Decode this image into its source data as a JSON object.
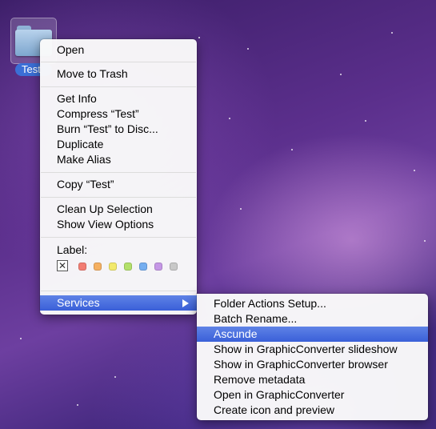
{
  "desktop": {
    "folder_label": "Test"
  },
  "context_menu": {
    "open": "Open",
    "move_to_trash": "Move to Trash",
    "get_info": "Get Info",
    "compress": "Compress “Test”",
    "burn": "Burn “Test” to Disc...",
    "duplicate": "Duplicate",
    "make_alias": "Make Alias",
    "copy": "Copy “Test”",
    "clean_up": "Clean Up Selection",
    "show_view_options": "Show View Options",
    "label_heading": "Label:",
    "label_none_glyph": "✕",
    "label_colors": [
      "#f27d73",
      "#f5b061",
      "#f2e96b",
      "#b3e06a",
      "#75aef0",
      "#c597e6",
      "#c8c8c8"
    ],
    "services": "Services"
  },
  "services_submenu": {
    "items": [
      "Folder Actions Setup...",
      "Batch Rename...",
      "Ascunde",
      "Show in GraphicConverter slideshow",
      "Show in GraphicConverter browser",
      "Remove metadata",
      "Open in GraphicConverter",
      "Create icon and preview"
    ],
    "highlighted_index": 2
  },
  "colors": {
    "highlight": "#3a5fd8"
  }
}
